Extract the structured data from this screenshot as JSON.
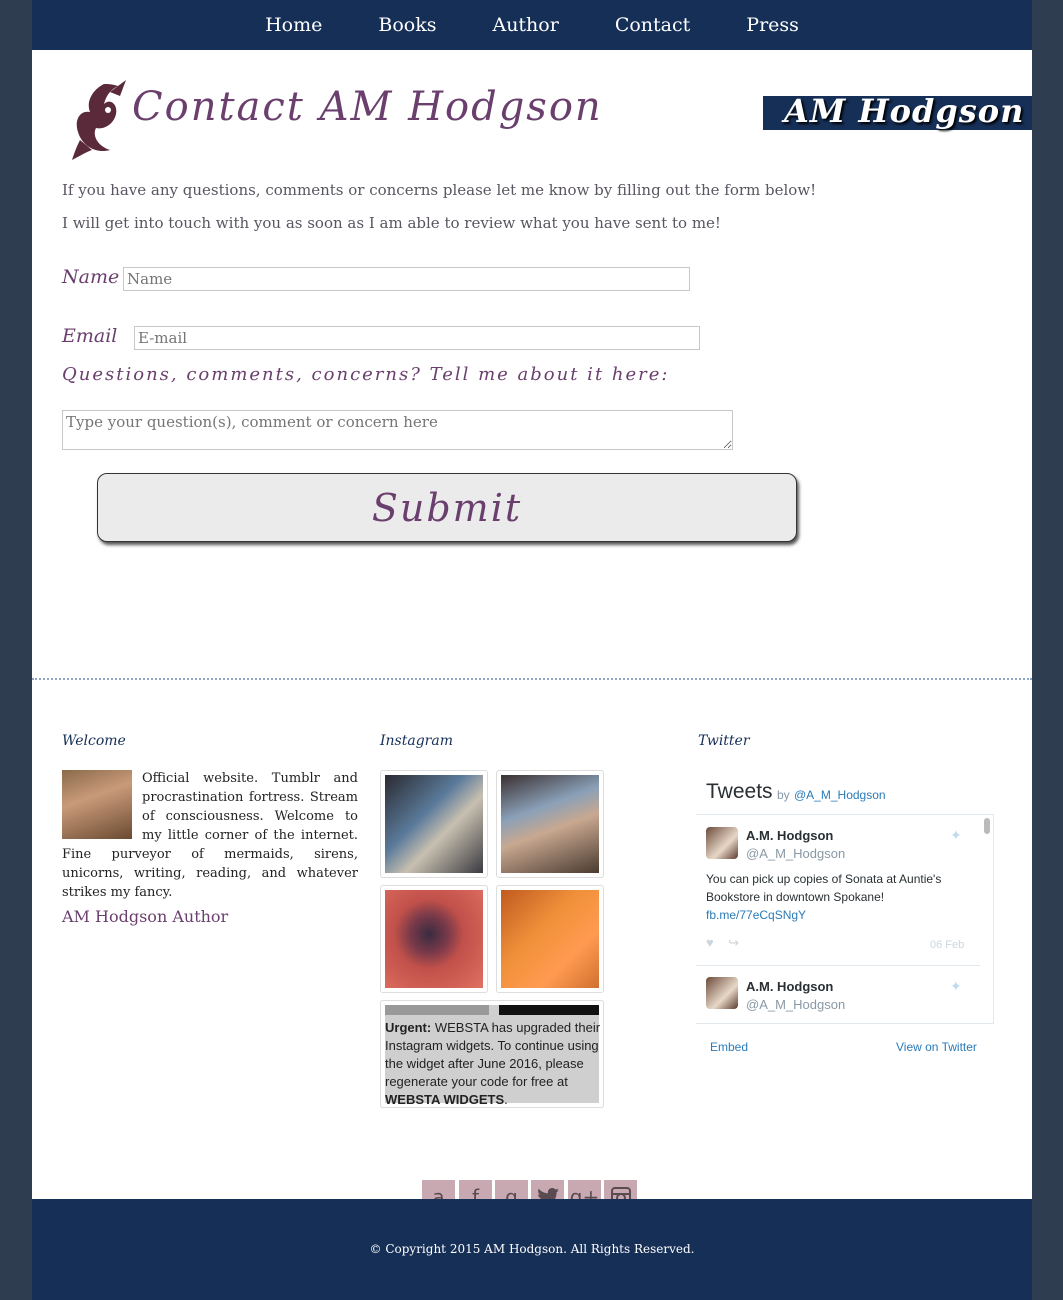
{
  "nav": {
    "items": [
      {
        "label": "Home"
      },
      {
        "label": "Books"
      },
      {
        "label": "Author"
      },
      {
        "label": "Contact"
      },
      {
        "label": "Press"
      }
    ]
  },
  "header": {
    "title": "Contact AM Hodgson",
    "brand": "AM Hodgson"
  },
  "intro": {
    "line1": "If you have any questions, comments or concerns please let me know by filling out the form below!",
    "line2": "I will get into touch with you as soon as I am able to review what you have sent to me!"
  },
  "form": {
    "name_label": "Name",
    "name_placeholder": "Name",
    "email_label": "Email",
    "email_placeholder": "E-mail",
    "message_label": "Questions, comments, concerns? Tell me about it here:",
    "message_placeholder": "Type your question(s), comment or concern here",
    "submit_label": "Submit"
  },
  "footer_widgets": {
    "welcome": {
      "title": "Welcome",
      "text": "Official website. Tumblr and procrastination fortress. Stream of consciousness. Welcome to my little corner of the internet. Fine purveyor of mermaids, sirens, unicorns, writing, reading, and whatever strikes my fancy.",
      "author_link": "AM Hodgson Author"
    },
    "instagram": {
      "title": "Instagram",
      "notice_bold": "Urgent:",
      "notice_text": " WEBSTA has upgraded their Instagram widgets. To continue using the widget after June 2016, please regenerate your code for free at ",
      "notice_link": "WEBSTA WIDGETS",
      "notice_end": "."
    },
    "twitter": {
      "title": "Twitter",
      "heading": "Tweets",
      "by": "by",
      "handle_link": "@A_M_Hodgson",
      "tweets": [
        {
          "name": "A.M. Hodgson",
          "handle": "@A_M_Hodgson",
          "text": "You can pick up copies of Sonata at Auntie's Bookstore in downtown Spokane!",
          "link": "fb.me/77eCqSNgY",
          "date": "06 Feb"
        },
        {
          "name": "A.M. Hodgson",
          "handle": "@A_M_Hodgson"
        }
      ],
      "embed": "Embed",
      "view": "View on Twitter"
    }
  },
  "social": {
    "icons": [
      "amazon-icon",
      "facebook-icon",
      "goodreads-icon",
      "twitter-icon",
      "google-plus-icon",
      "instagram-icon"
    ],
    "glyphs": [
      "a",
      "f",
      "g",
      "🐦",
      "g+",
      "◙"
    ]
  },
  "footer": {
    "copyright": "© Copyright 2015 AM Hodgson. All Rights Reserved."
  },
  "colors": {
    "navy": "#162f57",
    "plum": "#6a3f6e",
    "outer_bg": "#2e3e50",
    "social_bg": "#c9a9b1"
  }
}
